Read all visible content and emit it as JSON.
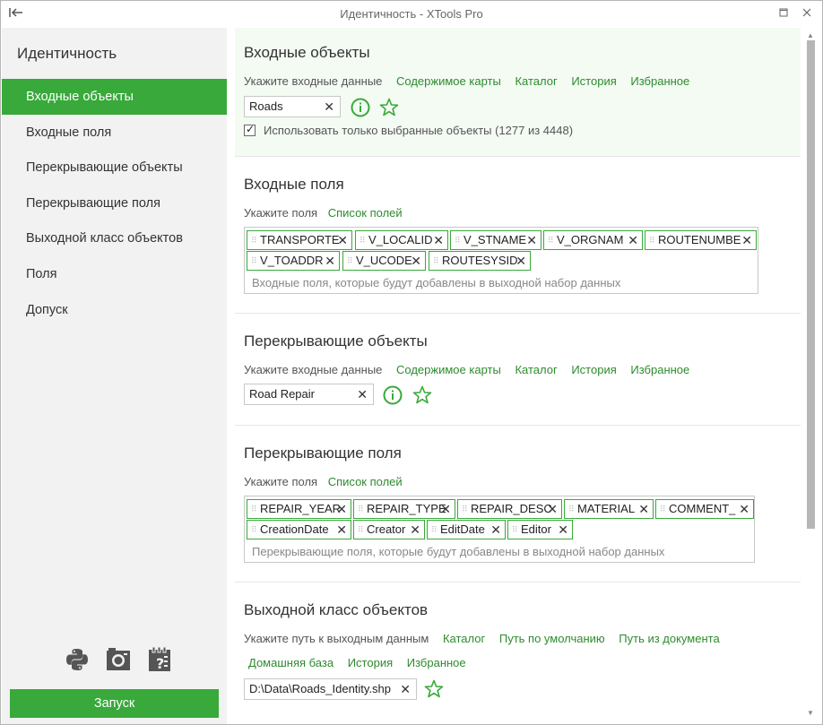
{
  "window": {
    "title": "Идентичность - XTools Pro",
    "collapse_glyph": "|←",
    "maximize_glyph": "▫",
    "close_glyph": "✕"
  },
  "sidebar": {
    "heading": "Идентичность",
    "items": [
      {
        "label": "Входные объекты",
        "active": true
      },
      {
        "label": "Входные поля"
      },
      {
        "label": "Перекрывающие объекты"
      },
      {
        "label": "Перекрывающие поля"
      },
      {
        "label": "Выходной класс объектов"
      },
      {
        "label": "Поля"
      },
      {
        "label": "Допуск"
      }
    ],
    "tools": [
      "python-icon",
      "camera-icon",
      "help-document-icon"
    ],
    "run_label": "Запуск"
  },
  "input_features": {
    "title": "Входные объекты",
    "prompt": "Укажите входные данные",
    "links": [
      "Содержимое карты",
      "Каталог",
      "История",
      "Избранное"
    ],
    "value": "Roads",
    "use_selected_label": "Использовать только выбранные объекты (1277 из 4448)",
    "use_selected_checked": true
  },
  "input_fields": {
    "title": "Входные поля",
    "prompt": "Укажите поля",
    "link": "Список полей",
    "tags": [
      "TRANSPORTE",
      "V_LOCALID",
      "V_STNAME",
      "V_ORGNAM",
      "ROUTENUMBE",
      "V_TOADDR",
      "V_UCODE",
      "ROUTESYSID"
    ],
    "placeholder": "Входные поля, которые будут добавлены в выходной набор данных"
  },
  "overlay_features": {
    "title": "Перекрывающие объекты",
    "prompt": "Укажите входные данные",
    "links": [
      "Содержимое карты",
      "Каталог",
      "История",
      "Избранное"
    ],
    "value": "Road Repair"
  },
  "overlay_fields": {
    "title": "Перекрывающие поля",
    "prompt": "Укажите поля",
    "link": "Список полей",
    "tags": [
      "REPAIR_YEAR",
      "REPAIR_TYPE",
      "REPAIR_DESC",
      "MATERIAL",
      "COMMENT_",
      "CreationDate",
      "Creator",
      "EditDate",
      "Editor"
    ],
    "placeholder": "Перекрывающие поля, которые будут добавлены в выходной набор данных"
  },
  "output": {
    "title": "Выходной класс объектов",
    "prompt": "Укажите путь к выходным данным",
    "links": [
      "Каталог",
      "Путь по умолчанию",
      "Путь из документа",
      "Домашняя база",
      "История",
      "Избранное"
    ],
    "value": "D:\\Data\\Roads_Identity.shp"
  },
  "colors": {
    "accent": "#38a93a",
    "link": "#2e8b2e",
    "sidebar_bg": "#f2f2f2",
    "active_section_bg": "#f3fbf3"
  }
}
